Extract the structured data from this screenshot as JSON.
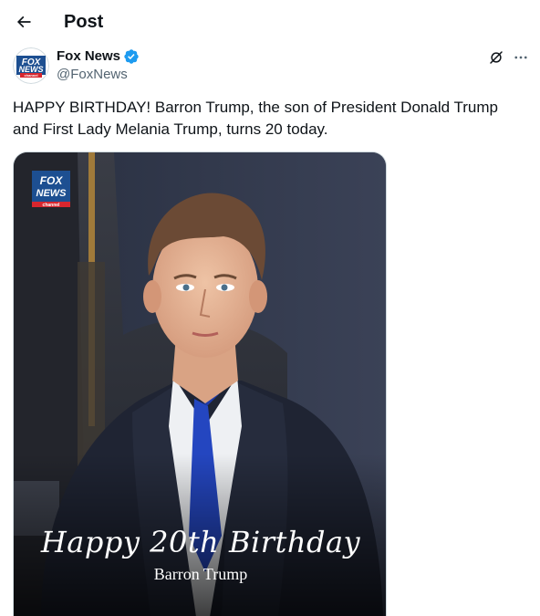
{
  "header": {
    "title": "Post",
    "back_icon": "arrow-left-icon"
  },
  "author": {
    "display_name": "Fox News",
    "handle": "@FoxNews",
    "verified": true,
    "verified_color": "#1d9bf0",
    "avatar_lines": [
      "FOX",
      "NEWS",
      "channel"
    ]
  },
  "actions": {
    "grok_icon": "grok-icon",
    "more_icon": "more-horizontal-icon"
  },
  "tweet": {
    "text": "HAPPY BIRTHDAY! Barron Trump, the son of President Donald Trump and First Lady Melania Trump, turns 20 today."
  },
  "media": {
    "caption_main": "Happy 20th Birthday",
    "caption_sub": "Barron Trump",
    "logo_lines": [
      "FOX",
      "NEWS",
      "channel"
    ]
  },
  "colors": {
    "brand_blue": "#1d4f91",
    "brand_red": "#d8262e",
    "text": "#0f1419",
    "secondary": "#536471"
  }
}
